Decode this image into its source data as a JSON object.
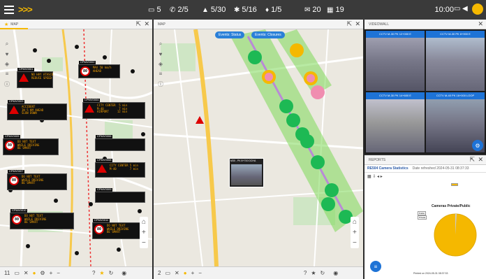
{
  "topbar": {
    "logo": ">>>",
    "stats": [
      {
        "icon": "list-icon",
        "glyph": "▭",
        "value": "5"
      },
      {
        "icon": "phone-icon",
        "glyph": "✆",
        "value": "2/5"
      },
      {
        "icon": "warning-icon",
        "glyph": "▲",
        "value": "5/30"
      },
      {
        "icon": "star-icon",
        "glyph": "✱",
        "value": "5/16"
      },
      {
        "icon": "bell-icon",
        "glyph": "♦",
        "value": "1/5"
      },
      {
        "icon": "mail-icon",
        "glyph": "✉",
        "value": "20"
      },
      {
        "icon": "calendar-icon",
        "glyph": "▦",
        "value": "19"
      }
    ],
    "clock": "10:00"
  },
  "map1": {
    "title": "MAP",
    "bottom_count": "11",
    "vms": [
      {
        "id": "CPMV0001",
        "text": "NO HAY ATASCO\nREDUCE SPEED",
        "sign": "tri"
      },
      {
        "id": "CPMV0002",
        "text": "MAX 50 km/h\nAHEAD",
        "sign": "80"
      },
      {
        "id": "CPMV0003",
        "text": "ACCIDENT\nIN 5 KM AHEAD\nSLOW DOWN",
        "sign": "tri"
      },
      {
        "id": "CPMV0004",
        "text": "CITY CENTER  5 min\nM-40         7 min\nAIRPORT     12 min",
        "sign": "tri"
      },
      {
        "id": "CPMV0005",
        "text": "DO NOT TEXT\nWHILE DRIVING\nBE SMART",
        "sign": "80"
      },
      {
        "id": "CPMV0006",
        "text": "",
        "sign": "none"
      },
      {
        "id": "CPMV0007",
        "text": "DO NOT TEXT\nWHILE DRIVING\nBE SMART",
        "sign": "80"
      },
      {
        "id": "CPMV0008",
        "text": "CITY CENTER 5 min\nM-40        7 min",
        "sign": "tri"
      },
      {
        "id": "CPMV0009",
        "text": "",
        "sign": "none"
      },
      {
        "id": "CPMV0010",
        "text": "DO NOT TEXT\nWHILE DRIVING\nBE SMART",
        "sign": "80"
      },
      {
        "id": "CPMV0011",
        "text": "DO NOT TEXT\nWHILE DRIVING\nBE SMART",
        "sign": "80"
      }
    ]
  },
  "map2": {
    "title": "MAP",
    "bottom_count": "2",
    "pills": [
      "Events: Status",
      "Events: Closures"
    ],
    "cam_popup": "M30 - PK 8+700 DCHA"
  },
  "videowall": {
    "title": "VIDEOWALL",
    "cams": [
      "CCTV M-30 PK 12+000 E",
      "CCTV M-30 PK 8+900 E",
      "CCTV M-30 PK 14+600 E",
      "CCTV M-40 PK 16+000 LOOP"
    ]
  },
  "reports": {
    "title": "REPORTS",
    "header": "RE504 Camera Statistics",
    "refresh": "Date refreshed 2024-05-31 08:37:33",
    "chart_title": "Cameras Private/Public",
    "legend": [
      "Public",
      "Private"
    ],
    "footer": "Printed on 2024-05-31 08:37:33"
  },
  "colors": {
    "accent": "#f5b800",
    "blue": "#1e73d6",
    "green": "#1db954",
    "corridor": "#7ed957"
  }
}
